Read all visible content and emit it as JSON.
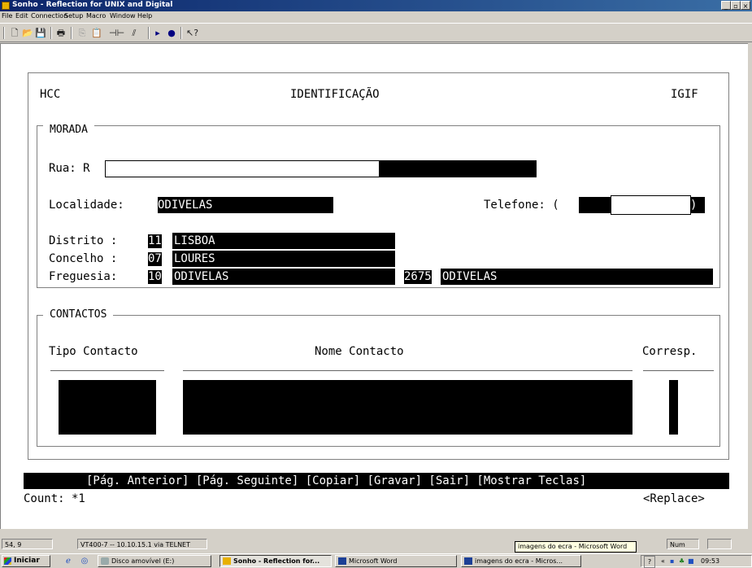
{
  "window": {
    "title": "Sonho - Reflection for UNIX and Digital",
    "controls": [
      "_",
      "▫",
      "×"
    ]
  },
  "menu": [
    "File",
    "Edit",
    "Connection",
    "Setup",
    "Macro",
    "Window",
    "Help"
  ],
  "toolbar": {
    "icons": [
      "new-icon",
      "open-icon",
      "save-icon",
      "print-icon",
      "copy-icon",
      "paste-icon",
      "connect-icon",
      "disconnect-icon",
      "play-icon",
      "record-icon",
      "help-pointer-icon"
    ]
  },
  "terminal": {
    "header": {
      "left": "HCC",
      "center": "IDENTIFICAÇÃO",
      "right": "IGIF"
    },
    "morada": {
      "legend": "MORADA",
      "rua_label": "Rua: R",
      "localidade_label": "Localidade:",
      "localidade_value": "ODIVELAS",
      "telefone_label": "Telefone: (",
      "telefone_tail": ")",
      "distrito_label": "Distrito :",
      "distrito_code": "11",
      "distrito_name": "LISBOA",
      "concelho_label": "Concelho :",
      "concelho_code": "07",
      "concelho_name": "LOURES",
      "freguesia_label": "Freguesia:",
      "freguesia_code": "10",
      "freguesia_name": "ODIVELAS",
      "postal_code": "2675",
      "postal_locality": "ODIVELAS"
    },
    "contactos": {
      "legend": "CONTACTOS",
      "col_tipo": "Tipo Contacto",
      "col_nome": "Nome Contacto",
      "col_corresp": "Corresp."
    },
    "function_keys": "[Pág. Anterior] [Pág. Seguinte] [Copiar] [Gravar] [Sair] [Mostrar Teclas]",
    "count": "Count: *1",
    "mode": "<Replace>"
  },
  "statusbar": {
    "cursor": "54, 9",
    "connection": "VT400-7 -- 10.10.15.1 via TELNET",
    "num": "Num",
    "tooltip": "imagens do ecra - Microsoft Word"
  },
  "taskbar": {
    "start_label": "Iniciar",
    "tasks": [
      {
        "label": "Disco amovível (E:)"
      },
      {
        "label": "Sonho - Reflection for..."
      },
      {
        "label": "Microsoft Word"
      },
      {
        "label": "imagens do ecra - Micros..."
      }
    ],
    "tray_time": "09:53",
    "tray_chevron": "«",
    "tray_help": "?"
  }
}
